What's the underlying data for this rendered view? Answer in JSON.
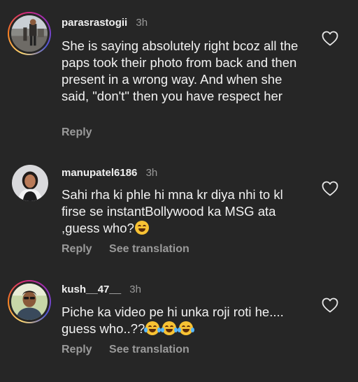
{
  "comments": [
    {
      "username": "parasrastogii",
      "time": "3h",
      "text": "She is saying absolutely right bcoz all the paps took their photo from back and then present in a wrong way. And when she said, \"don't\" then you have respect her",
      "reply_label": "Reply",
      "avatar": "avatar-photo-person-standing",
      "has_story_ring": true
    },
    {
      "username": "manupatel6186",
      "time": "3h",
      "text": "Sahi rha ki phle hi mna kr diya nhi to kl firse se instantBollywood  ka MSG ata ,guess who?",
      "reply_label": "Reply",
      "translate_label": "See translation",
      "avatar": "avatar-photo-woman",
      "has_story_ring": false
    },
    {
      "username": "kush__47__",
      "time": "3h",
      "text": "Piche ka video pe hi unka roji roti he.... guess who..??",
      "reply_label": "Reply",
      "translate_label": "See translation",
      "avatar": "avatar-photo-man",
      "has_story_ring": true
    }
  ],
  "icons": {
    "like": "heart-outline-icon",
    "grin_emoji": "grinning-squinting-face",
    "tears_emoji": "face-with-tears-of-joy"
  },
  "colors": {
    "background": "#262626",
    "text": "#f2f2f2",
    "muted": "#9a9a9a"
  }
}
